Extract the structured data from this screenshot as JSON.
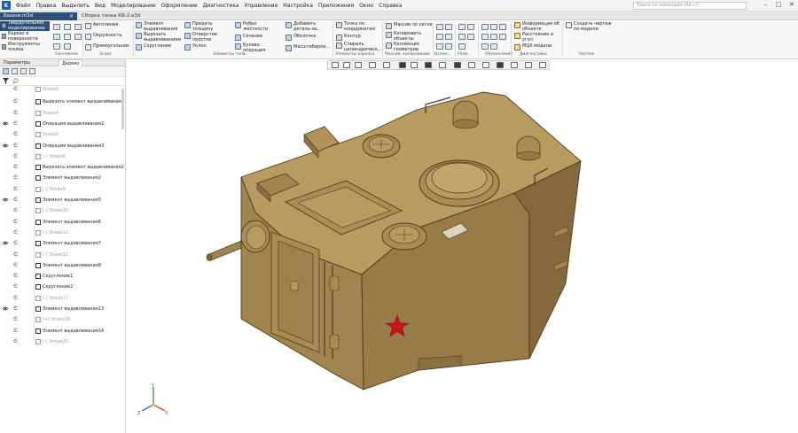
{
  "menu": {
    "logo": "K",
    "items": [
      "Файл",
      "Правка",
      "Выделить",
      "Вид",
      "Моделирование",
      "Оформление",
      "Диагностика",
      "Управление",
      "Настройка",
      "Приложения",
      "Окно",
      "Справка"
    ],
    "search_placeholder": "Поиск по командам (Alt+/)",
    "window_controls": [
      "–",
      "□",
      "✕"
    ]
  },
  "tabs": [
    {
      "label": "Башня.m3d",
      "active": true
    },
    {
      "label": "Сборка танка КВ-2.a3d",
      "active": false
    }
  ],
  "ribbon": {
    "modes": [
      "Твердотельное моделирование",
      "Каркас и поверхности",
      "Инструменты эскиза"
    ],
    "groups": {
      "sketch": "Системная",
      "esk": "Эскиз",
      "body": "Элементы тела",
      "frame": "Элементы каркаса",
      "array": "Массив, копирование",
      "vspom": "Вспом...",
      "razm": "Разм...",
      "oboz": "Обозначения",
      "diag": "Диагностика",
      "chert": "Чертеж"
    },
    "buttons": {
      "avtolinia": "Автолиния",
      "okruzhnost": "Окружность",
      "pryamougolnik": "Прямоугольник",
      "el_vydav": "Элемент выдавливания",
      "vyrezat": "Вырезать выдавливанием",
      "skruglenie": "Скругление",
      "pridat": "Придать толщину",
      "otverstie": "Отверстие простое",
      "uklon": "Уклон",
      "rebro": "Ребро жесткости",
      "sechenie": "Сечение",
      "buleva": "Булева операция",
      "dobavit": "Добавить деталь-за...",
      "obolochka": "Оболочка",
      "masshtab": "Масштабиров...",
      "tochka": "Точка по координатам",
      "kontur": "Контур",
      "spiral": "Спираль цилиндрическ...",
      "massiv": "Массив по сетке",
      "kopirovat": "Копировать объекты",
      "kollekcia": "Коллекция геометрии",
      "info": "Информация об объекте",
      "rasstoyanie": "Расстояние и угол",
      "mcx": "МЦХ модели",
      "sozdat": "Создать чертеж по модели"
    }
  },
  "left_panel": {
    "tabs": [
      "Параметры",
      "Дерево"
    ],
    "tree": [
      {
        "label": "Эскиз1",
        "kind": "sketch",
        "eye": false,
        "partial": true
      },
      {
        "label": "Вырезать элемент выдавливания1",
        "kind": "feature",
        "eye": false
      },
      {
        "label": "Эскиз4",
        "kind": "sketch",
        "eye": false
      },
      {
        "label": "Операция выдавливания2",
        "kind": "feature",
        "eye": true
      },
      {
        "label": "Эскиз5",
        "kind": "sketch",
        "eye": false
      },
      {
        "label": "Операция выдавливания3",
        "kind": "feature",
        "eye": true
      },
      {
        "label": "(-) Эскиз6",
        "kind": "sketch",
        "eye": false
      },
      {
        "label": "Вырезать элемент выдавливания2",
        "kind": "feature",
        "eye": false
      },
      {
        "label": "Элемент выдавливания2",
        "kind": "feature",
        "eye": false
      },
      {
        "label": "(-) Эскиз9",
        "kind": "sketch",
        "eye": false
      },
      {
        "label": "Элемент выдавливания5",
        "kind": "feature",
        "eye": true
      },
      {
        "label": "(-) Эскиз10",
        "kind": "sketch",
        "eye": false
      },
      {
        "label": "Элемент выдавливания6",
        "kind": "feature",
        "eye": false
      },
      {
        "label": "(-) Эскиз11",
        "kind": "sketch",
        "eye": false
      },
      {
        "label": "Элемент выдавливания7",
        "kind": "feature",
        "eye": true
      },
      {
        "label": "(-) Эскиз12",
        "kind": "sketch",
        "eye": false
      },
      {
        "label": "Элемент выдавливания8",
        "kind": "feature",
        "eye": false
      },
      {
        "label": "Скругление1",
        "kind": "feature",
        "eye": false
      },
      {
        "label": "Скругление2",
        "kind": "feature",
        "eye": false
      },
      {
        "label": "(-) Эскиз17",
        "kind": "sketch",
        "eye": false
      },
      {
        "label": "Элемент выдавливания13",
        "kind": "feature",
        "eye": true
      },
      {
        "label": "(+) Эскиз18",
        "kind": "sketch",
        "eye": false
      },
      {
        "label": "Элемент выдавливания14",
        "kind": "feature",
        "eye": false
      },
      {
        "label": "(-) Эскиз25",
        "kind": "sketch",
        "eye": false
      }
    ]
  },
  "axis_labels": {
    "x": "X",
    "y": "Y",
    "z": "Z"
  },
  "colors": {
    "accent": "#2d4f7c",
    "model_light": "#b5975b",
    "model_mid": "#a1854e",
    "model_dark": "#8a7041",
    "star": "#c4161c"
  }
}
